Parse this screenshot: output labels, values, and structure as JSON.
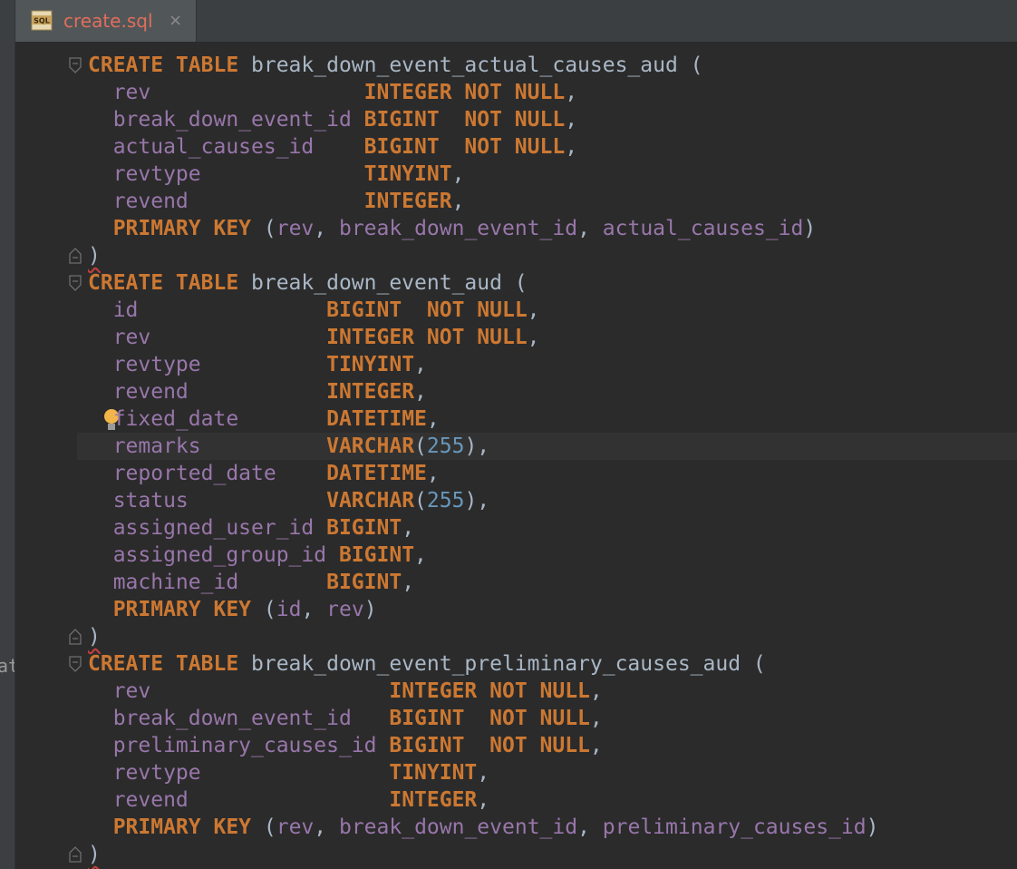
{
  "left_strip": {
    "text": "at"
  },
  "tab": {
    "icon": "sql-file-icon",
    "icon_text": "SQL",
    "label": "create.sql",
    "close": "×"
  },
  "code_lines": [
    [
      [
        "kw",
        "CREATE TABLE "
      ],
      [
        "plain",
        "break_down_event_actual_causes_aud ("
      ]
    ],
    [
      [
        "col",
        "  rev                 "
      ],
      [
        "kw",
        "INTEGER NOT NULL"
      ],
      [
        "plain",
        ","
      ]
    ],
    [
      [
        "col",
        "  break_down_event_id "
      ],
      [
        "kw",
        "BIGINT  NOT NULL"
      ],
      [
        "plain",
        ","
      ]
    ],
    [
      [
        "col",
        "  actual_causes_id    "
      ],
      [
        "kw",
        "BIGINT  NOT NULL"
      ],
      [
        "plain",
        ","
      ]
    ],
    [
      [
        "col",
        "  revtype             "
      ],
      [
        "kw",
        "TINYINT"
      ],
      [
        "plain",
        ","
      ]
    ],
    [
      [
        "col",
        "  revend              "
      ],
      [
        "kw",
        "INTEGER"
      ],
      [
        "plain",
        ","
      ]
    ],
    [
      [
        "kw",
        "  PRIMARY KEY "
      ],
      [
        "plain",
        "("
      ],
      [
        "col",
        "rev"
      ],
      [
        "plain",
        ", "
      ],
      [
        "col",
        "break_down_event_id"
      ],
      [
        "plain",
        ", "
      ],
      [
        "col",
        "actual_causes_id"
      ],
      [
        "plain",
        ")"
      ]
    ],
    [
      [
        "err",
        ")"
      ]
    ],
    [
      [
        "kw",
        "CREATE TABLE "
      ],
      [
        "plain",
        "break_down_event_aud ("
      ]
    ],
    [
      [
        "col",
        "  id               "
      ],
      [
        "kw",
        "BIGINT  NOT NULL"
      ],
      [
        "plain",
        ","
      ]
    ],
    [
      [
        "col",
        "  rev              "
      ],
      [
        "kw",
        "INTEGER NOT NULL"
      ],
      [
        "plain",
        ","
      ]
    ],
    [
      [
        "col",
        "  revtype          "
      ],
      [
        "kw",
        "TINYINT"
      ],
      [
        "plain",
        ","
      ]
    ],
    [
      [
        "col",
        "  revend           "
      ],
      [
        "kw",
        "INTEGER"
      ],
      [
        "plain",
        ","
      ]
    ],
    [
      [
        "col",
        "  fixed_date       "
      ],
      [
        "kw",
        "DATETIME"
      ],
      [
        "plain",
        ","
      ]
    ],
    [
      [
        "col",
        "  remarks          "
      ],
      [
        "kw",
        "VARCHAR"
      ],
      [
        "plain",
        "("
      ],
      [
        "num",
        "255"
      ],
      [
        "plain",
        "),"
      ]
    ],
    [
      [
        "col",
        "  reported_date    "
      ],
      [
        "kw",
        "DATETIME"
      ],
      [
        "plain",
        ","
      ]
    ],
    [
      [
        "col",
        "  status           "
      ],
      [
        "kw",
        "VARCHAR"
      ],
      [
        "plain",
        "("
      ],
      [
        "num",
        "255"
      ],
      [
        "plain",
        "),"
      ]
    ],
    [
      [
        "col",
        "  assigned_user_id "
      ],
      [
        "kw",
        "BIGINT"
      ],
      [
        "plain",
        ","
      ]
    ],
    [
      [
        "col",
        "  assigned_group_id "
      ],
      [
        "kw",
        "BIGINT"
      ],
      [
        "plain",
        ","
      ]
    ],
    [
      [
        "col",
        "  machine_id       "
      ],
      [
        "kw",
        "BIGINT"
      ],
      [
        "plain",
        ","
      ]
    ],
    [
      [
        "kw",
        "  PRIMARY KEY "
      ],
      [
        "plain",
        "("
      ],
      [
        "col",
        "id"
      ],
      [
        "plain",
        ", "
      ],
      [
        "col",
        "rev"
      ],
      [
        "plain",
        ")"
      ]
    ],
    [
      [
        "err",
        ")"
      ]
    ],
    [
      [
        "kw",
        "CREATE TABLE "
      ],
      [
        "plain",
        "break_down_event_preliminary_causes_aud ("
      ]
    ],
    [
      [
        "col",
        "  rev                   "
      ],
      [
        "kw",
        "INTEGER NOT NULL"
      ],
      [
        "plain",
        ","
      ]
    ],
    [
      [
        "col",
        "  break_down_event_id   "
      ],
      [
        "kw",
        "BIGINT  NOT NULL"
      ],
      [
        "plain",
        ","
      ]
    ],
    [
      [
        "col",
        "  preliminary_causes_id "
      ],
      [
        "kw",
        "BIGINT  NOT NULL"
      ],
      [
        "plain",
        ","
      ]
    ],
    [
      [
        "col",
        "  revtype               "
      ],
      [
        "kw",
        "TINYINT"
      ],
      [
        "plain",
        ","
      ]
    ],
    [
      [
        "col",
        "  revend                "
      ],
      [
        "kw",
        "INTEGER"
      ],
      [
        "plain",
        ","
      ]
    ],
    [
      [
        "kw",
        "  PRIMARY KEY "
      ],
      [
        "plain",
        "("
      ],
      [
        "col",
        "rev"
      ],
      [
        "plain",
        ", "
      ],
      [
        "col",
        "break_down_event_id"
      ],
      [
        "plain",
        ", "
      ],
      [
        "col",
        "preliminary_causes_id"
      ],
      [
        "plain",
        ")"
      ]
    ],
    [
      [
        "err",
        ")"
      ]
    ]
  ],
  "fold_start_lines": [
    0,
    8,
    22
  ],
  "fold_end_lines": [
    7,
    21,
    29
  ],
  "intention_bulb_line": 13,
  "caret_line": 14,
  "colors": {
    "keyword": "#cc7832",
    "column": "#9876aa",
    "number": "#6897bb",
    "plain": "#a9b7c6",
    "error_underline": "#bc3f3c",
    "tab_label": "#e06e5c"
  }
}
